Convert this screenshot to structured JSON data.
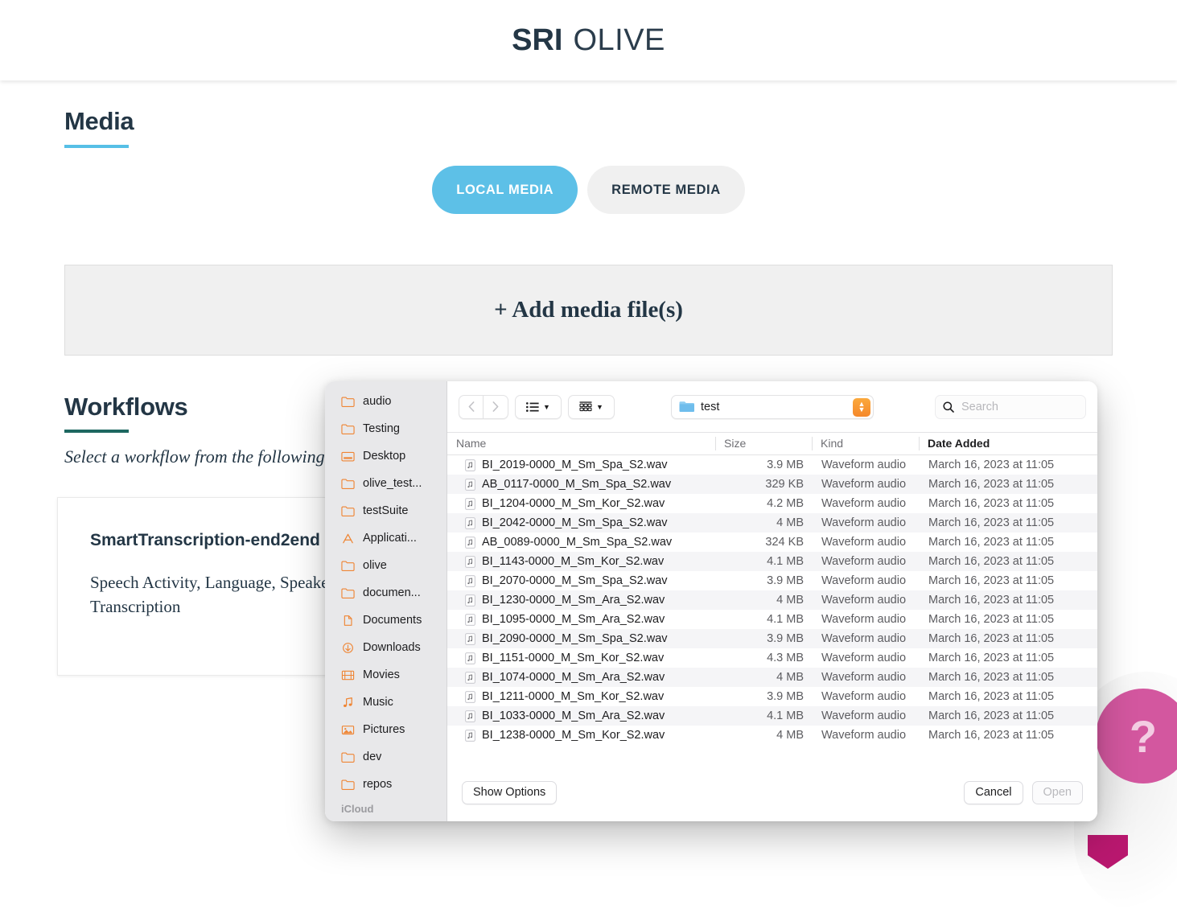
{
  "header": {
    "logo_primary": "SRI",
    "logo_secondary": "OLIVE"
  },
  "media": {
    "title": "Media",
    "accent_color": "#56bfe6",
    "tabs": [
      {
        "label": "LOCAL MEDIA",
        "active": true
      },
      {
        "label": "REMOTE MEDIA",
        "active": false
      }
    ],
    "dropzone_label": "+ Add media file(s)"
  },
  "workflows": {
    "title": "Workflows",
    "accent_color": "#1d6760",
    "subtitle": "Select a workflow from the following",
    "cards": [
      {
        "title": "SmartTranscription-end2end",
        "description": "Speech Activity, Language, Speaker, Transcription"
      }
    ]
  },
  "help_widget": {
    "glyph": "?"
  },
  "file_dialog": {
    "sidebar": {
      "items": [
        {
          "label": "audio",
          "icon": "folder-icon"
        },
        {
          "label": "Testing",
          "icon": "folder-icon"
        },
        {
          "label": "Desktop",
          "icon": "desktop-folder-icon"
        },
        {
          "label": "olive_test...",
          "icon": "folder-icon"
        },
        {
          "label": "testSuite",
          "icon": "folder-icon"
        },
        {
          "label": "Applicati...",
          "icon": "applications-icon"
        },
        {
          "label": "olive",
          "icon": "folder-icon"
        },
        {
          "label": "documen...",
          "icon": "folder-icon"
        },
        {
          "label": "Documents",
          "icon": "document-icon"
        },
        {
          "label": "Downloads",
          "icon": "downloads-icon"
        },
        {
          "label": "Movies",
          "icon": "movies-icon"
        },
        {
          "label": "Music",
          "icon": "music-icon"
        },
        {
          "label": "Pictures",
          "icon": "pictures-icon"
        },
        {
          "label": "dev",
          "icon": "folder-icon"
        },
        {
          "label": "repos",
          "icon": "folder-icon"
        }
      ],
      "section_label": "iCloud"
    },
    "toolbar": {
      "back_label": "‹",
      "forward_label": "›",
      "current_folder": "test",
      "search_placeholder": "Search",
      "search_value": ""
    },
    "columns": [
      {
        "key": "name",
        "label": "Name"
      },
      {
        "key": "size",
        "label": "Size"
      },
      {
        "key": "kind",
        "label": "Kind"
      },
      {
        "key": "date",
        "label": "Date Added"
      }
    ],
    "files": [
      {
        "name": "BI_2019-0000_M_Sm_Spa_S2.wav",
        "size": "3.9 MB",
        "kind": "Waveform audio",
        "date": "March 16, 2023 at 11:05"
      },
      {
        "name": "AB_0117-0000_M_Sm_Spa_S2.wav",
        "size": "329 KB",
        "kind": "Waveform audio",
        "date": "March 16, 2023 at 11:05"
      },
      {
        "name": "BI_1204-0000_M_Sm_Kor_S2.wav",
        "size": "4.2 MB",
        "kind": "Waveform audio",
        "date": "March 16, 2023 at 11:05"
      },
      {
        "name": "BI_2042-0000_M_Sm_Spa_S2.wav",
        "size": "4 MB",
        "kind": "Waveform audio",
        "date": "March 16, 2023 at 11:05"
      },
      {
        "name": "AB_0089-0000_M_Sm_Spa_S2.wav",
        "size": "324 KB",
        "kind": "Waveform audio",
        "date": "March 16, 2023 at 11:05"
      },
      {
        "name": "BI_1143-0000_M_Sm_Kor_S2.wav",
        "size": "4.1 MB",
        "kind": "Waveform audio",
        "date": "March 16, 2023 at 11:05"
      },
      {
        "name": "BI_2070-0000_M_Sm_Spa_S2.wav",
        "size": "3.9 MB",
        "kind": "Waveform audio",
        "date": "March 16, 2023 at 11:05"
      },
      {
        "name": "BI_1230-0000_M_Sm_Ara_S2.wav",
        "size": "4 MB",
        "kind": "Waveform audio",
        "date": "March 16, 2023 at 11:05"
      },
      {
        "name": "BI_1095-0000_M_Sm_Ara_S2.wav",
        "size": "4.1 MB",
        "kind": "Waveform audio",
        "date": "March 16, 2023 at 11:05"
      },
      {
        "name": "BI_2090-0000_M_Sm_Spa_S2.wav",
        "size": "3.9 MB",
        "kind": "Waveform audio",
        "date": "March 16, 2023 at 11:05"
      },
      {
        "name": "BI_1151-0000_M_Sm_Kor_S2.wav",
        "size": "4.3 MB",
        "kind": "Waveform audio",
        "date": "March 16, 2023 at 11:05"
      },
      {
        "name": "BI_1074-0000_M_Sm_Ara_S2.wav",
        "size": "4 MB",
        "kind": "Waveform audio",
        "date": "March 16, 2023 at 11:05"
      },
      {
        "name": "BI_1211-0000_M_Sm_Kor_S2.wav",
        "size": "3.9 MB",
        "kind": "Waveform audio",
        "date": "March 16, 2023 at 11:05"
      },
      {
        "name": "BI_1033-0000_M_Sm_Ara_S2.wav",
        "size": "4.1 MB",
        "kind": "Waveform audio",
        "date": "March 16, 2023 at 11:05"
      },
      {
        "name": "BI_1238-0000_M_Sm_Kor_S2.wav",
        "size": "4 MB",
        "kind": "Waveform audio",
        "date": "March 16, 2023 at 11:05"
      }
    ],
    "footer": {
      "show_options_label": "Show Options",
      "cancel_label": "Cancel",
      "open_label": "Open"
    }
  }
}
